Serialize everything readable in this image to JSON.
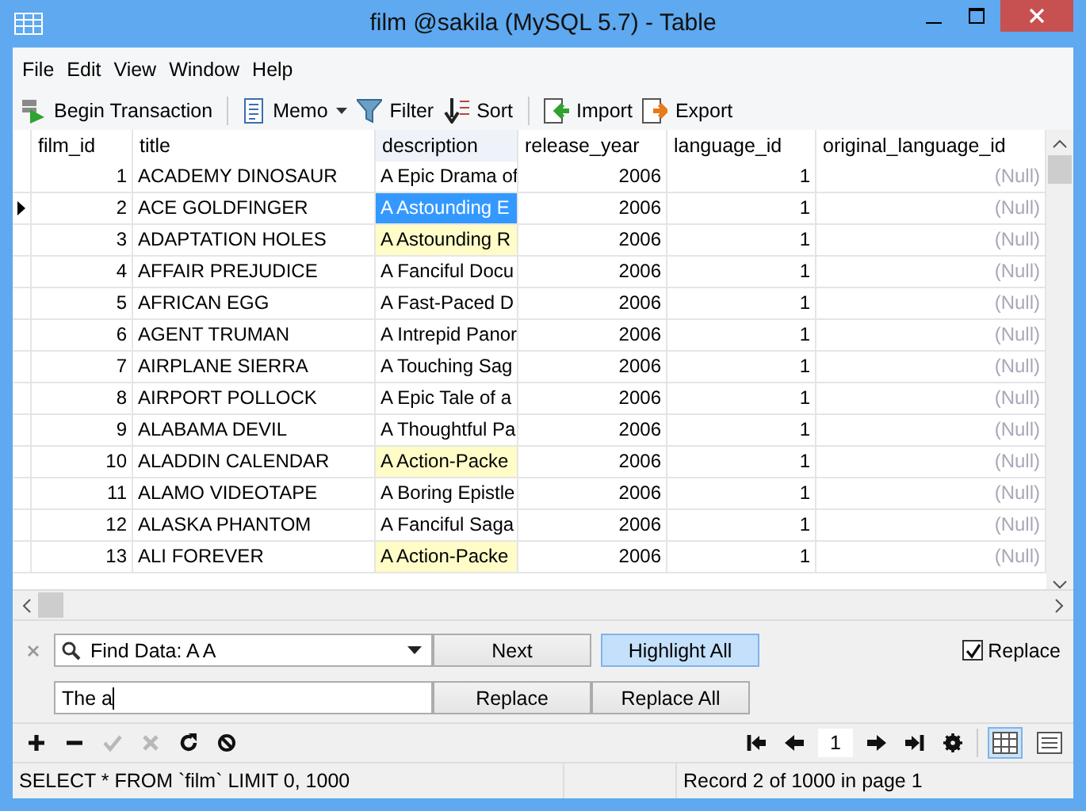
{
  "window": {
    "title": "film @sakila (MySQL 5.7) - Table"
  },
  "menu": [
    "File",
    "Edit",
    "View",
    "Window",
    "Help"
  ],
  "toolbar": [
    {
      "kind": "begin",
      "label": "Begin Transaction",
      "dropdown": false
    },
    {
      "kind": "memo",
      "label": "Memo",
      "dropdown": true
    },
    {
      "kind": "filter",
      "label": "Filter",
      "dropdown": false
    },
    {
      "kind": "sort",
      "label": "Sort",
      "dropdown": false
    },
    {
      "kind": "import",
      "label": "Import",
      "dropdown": false
    },
    {
      "kind": "export",
      "label": "Export",
      "dropdown": false
    }
  ],
  "table": {
    "columns": [
      "film_id",
      "title",
      "description",
      "release_year",
      "language_id",
      "original_language_id"
    ],
    "rows": [
      {
        "selected": false,
        "match": false,
        "cells": [
          "1",
          "ACADEMY DINOSAUR",
          "A Epic Drama of",
          "2006",
          "1",
          "(Null)"
        ]
      },
      {
        "selected": true,
        "match": false,
        "cells": [
          "2",
          "ACE GOLDFINGER",
          "A Astounding E",
          "2006",
          "1",
          "(Null)"
        ]
      },
      {
        "selected": false,
        "match": true,
        "cells": [
          "3",
          "ADAPTATION HOLES",
          "A Astounding R",
          "2006",
          "1",
          "(Null)"
        ]
      },
      {
        "selected": false,
        "match": false,
        "cells": [
          "4",
          "AFFAIR PREJUDICE",
          "A Fanciful Docu",
          "2006",
          "1",
          "(Null)"
        ]
      },
      {
        "selected": false,
        "match": false,
        "cells": [
          "5",
          "AFRICAN EGG",
          "A Fast-Paced D",
          "2006",
          "1",
          "(Null)"
        ]
      },
      {
        "selected": false,
        "match": false,
        "cells": [
          "6",
          "AGENT TRUMAN",
          "A Intrepid Panor",
          "2006",
          "1",
          "(Null)"
        ]
      },
      {
        "selected": false,
        "match": false,
        "cells": [
          "7",
          "AIRPLANE SIERRA",
          "A Touching Sag",
          "2006",
          "1",
          "(Null)"
        ]
      },
      {
        "selected": false,
        "match": false,
        "cells": [
          "8",
          "AIRPORT POLLOCK",
          "A Epic Tale of a",
          "2006",
          "1",
          "(Null)"
        ]
      },
      {
        "selected": false,
        "match": false,
        "cells": [
          "9",
          "ALABAMA DEVIL",
          "A Thoughtful Pa",
          "2006",
          "1",
          "(Null)"
        ]
      },
      {
        "selected": false,
        "match": true,
        "cells": [
          "10",
          "ALADDIN CALENDAR",
          "A Action-Packe",
          "2006",
          "1",
          "(Null)"
        ]
      },
      {
        "selected": false,
        "match": false,
        "cells": [
          "11",
          "ALAMO VIDEOTAPE",
          "A Boring Epistle",
          "2006",
          "1",
          "(Null)"
        ]
      },
      {
        "selected": false,
        "match": false,
        "cells": [
          "12",
          "ALASKA PHANTOM",
          "A Fanciful Saga",
          "2006",
          "1",
          "(Null)"
        ]
      },
      {
        "selected": false,
        "match": true,
        "cells": [
          "13",
          "ALI FOREVER",
          "A Action-Packe",
          "2006",
          "1",
          "(Null)"
        ]
      }
    ]
  },
  "find": {
    "search_value": "Find Data: A A",
    "next": "Next",
    "highlight_all": {
      "label": "Highlight All",
      "selected": true
    },
    "replace_value": "The a",
    "replace": "Replace",
    "replace_all": "Replace All",
    "replace_toggle": {
      "label": "Replace",
      "checked": true
    }
  },
  "edit_tools": [
    {
      "kind": "add",
      "disabled": false
    },
    {
      "kind": "delete",
      "disabled": false
    },
    {
      "kind": "apply",
      "disabled": true
    },
    {
      "kind": "discard",
      "disabled": true
    },
    {
      "kind": "refresh",
      "disabled": false
    },
    {
      "kind": "stop",
      "disabled": false
    }
  ],
  "pager": {
    "page": "1"
  },
  "view_modes": [
    {
      "kind": "grid",
      "selected": true
    },
    {
      "kind": "form",
      "selected": false
    }
  ],
  "status_bar": {
    "sql": "SELECT * FROM `film` LIMIT 0, 1000",
    "record": "Record 2 of 1000 in page 1"
  }
}
